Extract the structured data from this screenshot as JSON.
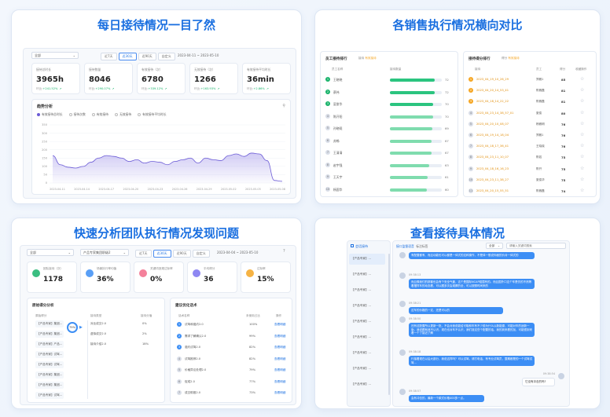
{
  "panels": {
    "reception": {
      "title": "每日接待情况一目了然",
      "filter_select": "全部",
      "date_tabs": [
        "近7天",
        "近30天",
        "近90天",
        "自定义"
      ],
      "date_range": "2023-04-11 ~ 2023-05-10",
      "kpis": [
        {
          "label": "接待总时长",
          "value": "3965h",
          "change_label": "环比:",
          "change": "+241.52%"
        },
        {
          "label": "接待数量",
          "value": "8046",
          "change_label": "环比:",
          "change": "+290.07%"
        },
        {
          "label": "有效接待（次）",
          "value": "6780",
          "change_label": "环比:",
          "change": "+339.12%"
        },
        {
          "label": "无效接待（次）",
          "value": "1266",
          "change_label": "环比:",
          "change": "+163.93%"
        },
        {
          "label": "有效接待平均时长",
          "value": "36min",
          "change_label": "环比:",
          "change": "+2.86%"
        }
      ],
      "trend_title": "趋势分析",
      "legend": [
        "有效接待总时长",
        "接待次数",
        "有效接待",
        "无效接待",
        "有效接待平均时长"
      ],
      "chart_data": {
        "type": "area",
        "y_ticks": [
          "350",
          "300",
          "250",
          "200",
          "150",
          "100",
          "50",
          "0"
        ],
        "x_ticks": [
          "2023-04-11",
          "2023-04-14",
          "2023-04-17",
          "2023-04-20",
          "2023-04-23",
          "2023-04-26",
          "2023-04-29",
          "2023-05-02",
          "2023-05-05",
          "2023-05-08"
        ],
        "ylim": [
          0,
          350
        ],
        "values": [
          165,
          110,
          95,
          90,
          100,
          125,
          150,
          165,
          160,
          150,
          130,
          140,
          120,
          130,
          125,
          110,
          130,
          140,
          150,
          120,
          150,
          140,
          135,
          165,
          175,
          160,
          180,
          175,
          135,
          15,
          10
        ]
      }
    },
    "sales": {
      "title": "各销售执行情况横向对比",
      "left_title": "员工接待排行",
      "left_tag": "接待",
      "left_tag2": "有效接待",
      "left_header": [
        "员工名称",
        "接待数量"
      ],
      "staff": [
        {
          "name": "王晓晓",
          "count": "72",
          "pct": 0.86
        },
        {
          "name": "蔡伟",
          "count": "72",
          "pct": 0.86
        },
        {
          "name": "夏俊华",
          "count": "70",
          "pct": 0.83
        },
        {
          "name": "陈开阳",
          "count": "70",
          "pct": 0.83
        },
        {
          "name": "孙晓曦",
          "count": "69",
          "pct": 0.82
        },
        {
          "name": "苏畅",
          "count": "67",
          "pct": 0.8
        },
        {
          "name": "王清清",
          "count": "67",
          "pct": 0.8
        },
        {
          "name": "赵宇强",
          "count": "63",
          "pct": 0.75
        },
        {
          "name": "王天宇",
          "count": "61",
          "pct": 0.73
        },
        {
          "name": "杨国华",
          "count": "60",
          "pct": 0.71
        }
      ],
      "right_title": "接待得分排行",
      "right_tag": "得分",
      "right_tag2": "有效接待",
      "right_header": [
        "接待",
        "员工",
        "得分",
        "收藏操作"
      ],
      "scores": [
        {
          "time": "2023_04_19_10_26_29",
          "staff": "郑雅1",
          "score": "85"
        },
        {
          "time": "2023_04_20_14_53_41",
          "staff": "陈雅磊",
          "score": "81"
        },
        {
          "time": "2023_04_18_14_22_22",
          "staff": "陈雅磊",
          "score": "81"
        },
        {
          "time": "2023_04_23_14_38_57_01",
          "staff": "夏俊",
          "score": "80"
        },
        {
          "time": "2023_04_20_10_08_07",
          "staff": "杨雅明",
          "score": "76"
        },
        {
          "time": "2023_04_19_14_18_04",
          "staff": "郑雅1",
          "score": "76"
        },
        {
          "time": "2023_04_18_17_36_41",
          "staff": "王晓晓",
          "score": "76"
        },
        {
          "time": "2023_04_23_11_10_07",
          "staff": "陈若",
          "score": "75"
        },
        {
          "time": "2023_04_18_16_16_23",
          "staff": "陈开",
          "score": "75"
        },
        {
          "time": "2023_04_23_11_38_27",
          "staff": "夏俊华",
          "score": "75"
        },
        {
          "time": "2023_04_20_15_55_51",
          "staff": "陈雅磊",
          "score": "74"
        }
      ]
    },
    "team": {
      "title": "快速分析团队执行情况发现问题",
      "filter_select": "全部",
      "filter_select2": "产品专家集团职级2",
      "date_tabs": [
        "近7天",
        "近30天",
        "近90天",
        "自定义"
      ],
      "date_range": "2023-04-04 ~ 2023-05-10",
      "kpis": [
        {
          "label": "团队接待（次）",
          "value": "1178",
          "color": "#19b36b"
        },
        {
          "label": "场景执行率均值",
          "value": "36%",
          "color": "#3c8ef5"
        },
        {
          "label": "关键词违规达标率",
          "value": "0%",
          "color": "#f26b8a"
        },
        {
          "label": "平均得分",
          "value": "36",
          "color": "#7a72f0"
        },
        {
          "label": "达标率",
          "value": "15%",
          "color": "#f5a623"
        }
      ],
      "score_title": "原始得分分析",
      "score_header": [
        "原始得分",
        "接待类型",
        "接待分值"
      ],
      "score_rows": [
        {
          "name": "【产品专家】集团...",
          "type": "对比成交2.0",
          "pct": "0%"
        },
        {
          "name": "【产品专家】集团...",
          "type": "虚拟成交2.0",
          "pct": "2%"
        },
        {
          "name": "【产品专家】产品...",
          "type": "接待介绍2.0",
          "pct": "18%"
        },
        {
          "name": "【产品专家】试驾..."
        },
        {
          "name": "【产品专家】试驾..."
        },
        {
          "name": "【产品专家】集团..."
        },
        {
          "name": "【产品专家】集团..."
        },
        {
          "name": "【产品专家】试驾..."
        }
      ],
      "score_center": "79%",
      "suggest_title": "建议优化话术",
      "suggest_header": [
        "话术名称",
        "未使用占比",
        "操作"
      ],
      "suggest_rows": [
        {
          "name": "试驾和邀约2.0",
          "pct": "100%",
          "op": "查看明细"
        },
        {
          "name": "需求了解确认2.0",
          "pct": "99%",
          "op": "查看明细"
        },
        {
          "name": "邀约试驾2.0",
          "pct": "82%",
          "op": "查看明细"
        },
        {
          "name": "试驾推荐2.0",
          "pct": "82%",
          "op": "查看明细"
        },
        {
          "name": "价格异议处理2.0",
          "pct": "79%",
          "op": "查看明细"
        },
        {
          "name": "促成2.0",
          "pct": "77%",
          "op": "查看明细"
        },
        {
          "name": "成交助推2.0",
          "pct": "73%",
          "op": "查看明细"
        }
      ]
    },
    "detail": {
      "title": "查看接待具体情况",
      "side_title": "会话接待",
      "side_items": [
        "【产品专家】...",
        "【产品专家】...",
        "【产品专家】...",
        "【产品专家】...",
        "【产品专家】...",
        "【产品专家】...",
        "【产品专家】...",
        "【产品专家】...",
        "【产品专家】..."
      ],
      "tabs": [
        "接口监督语音",
        "标注标签"
      ],
      "search_select": "全部",
      "search_placeholder": "请输入关键词搜索",
      "messages": [
        {
          "side": "left",
          "time": "",
          "text": "有配置都有、而且动能也可以都是一体式的这种操作，不是体一般说你面的价对一体式的"
        },
        {
          "side": "left",
          "time": "09:38:13",
          "text": "而且像我们的那套也会有个安全气囊，这个是国际NCAP碰撞有的。而且国外口这个车是仿的不然等着摆样车的动态看，可以跟多次会观察的全，可以按照时间来的"
        },
        {
          "side": "left",
          "time": "09:38:21",
          "text": "这车的价格的一定，还是可以的"
        },
        {
          "side": "left",
          "time": "09:38:50",
          "text": "还有这配置所以更新一批，不会对我说能给可取和车有不少前为什么以新能源，可能对车的适新一版，我说跟就我不认识，现在也对车不认识，我们准这些个配置的话，我的到来看的加，可能很到来看一个了接近了解"
        },
        {
          "side": "left",
          "time": "09:38:18",
          "text": "行接着现在以后大部分，我说这样吗？可以试驾，请打电话，有专业试驾员，整期都是的一个试驾试驾..."
        },
        {
          "side": "right",
          "time": "09:38:54",
          "text": "它没有冲击的吗?"
        },
        {
          "side": "left",
          "time": "09:38:57",
          "text": "会有冲击的，最新一个款式价格400多一点。"
        }
      ]
    }
  }
}
